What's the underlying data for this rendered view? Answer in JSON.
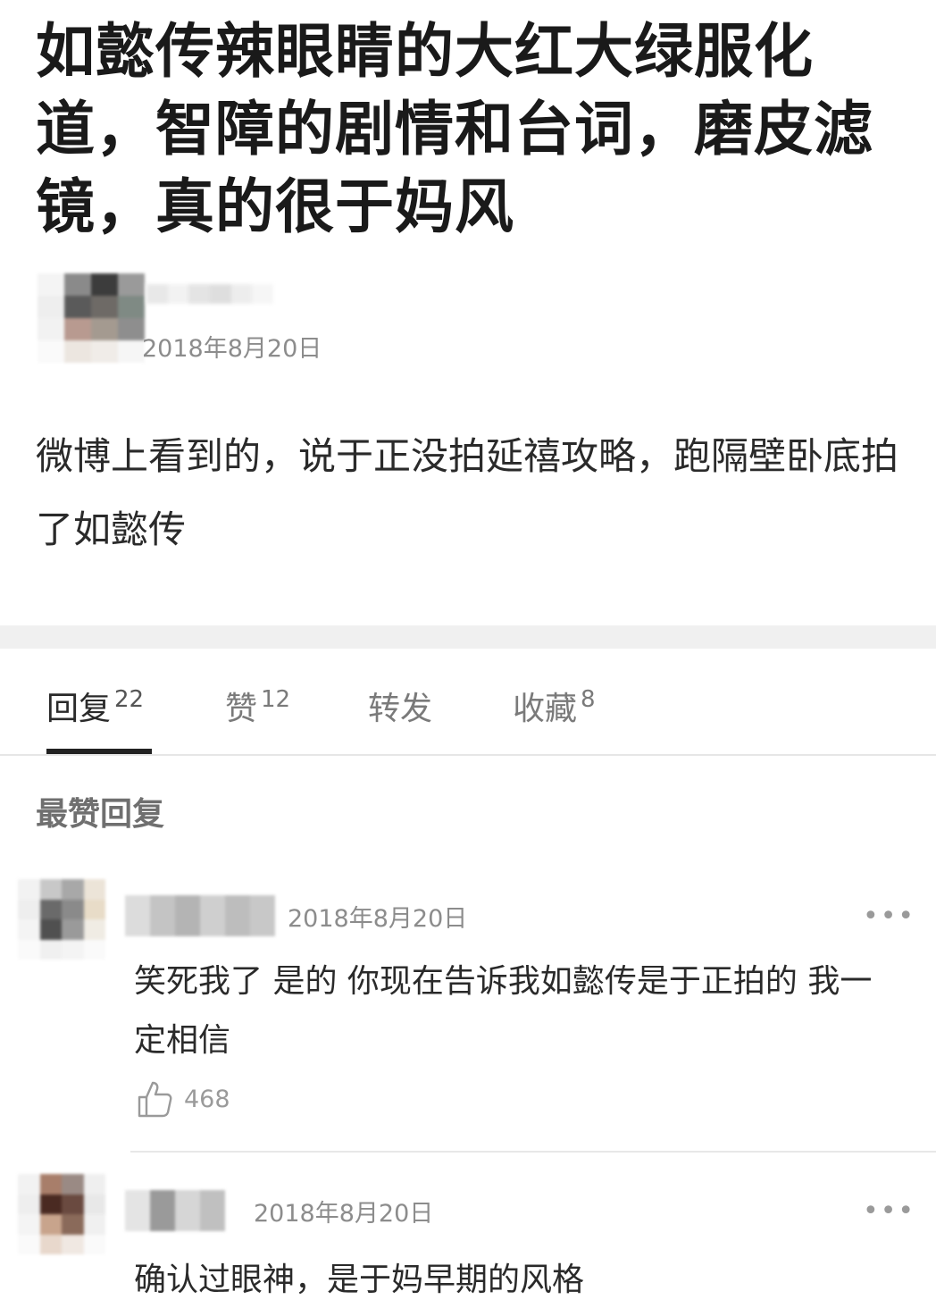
{
  "post": {
    "title": "如懿传辣眼睛的大红大绿服化道，智障的剧情和台词，磨皮滤镜，真的很于妈风",
    "date": "2018年8月20日",
    "body": "微博上看到的，说于正没拍延禧攻略，跑隔壁卧底拍了如懿传"
  },
  "tabs": [
    {
      "label": "回复",
      "count": "22"
    },
    {
      "label": "赞",
      "count": "12"
    },
    {
      "label": "转发",
      "count": ""
    },
    {
      "label": "收藏",
      "count": "8"
    }
  ],
  "section_title": "最赞回复",
  "comments": [
    {
      "date": "2018年8月20日",
      "text": "笑死我了 是的 你现在告诉我如懿传是于正拍的 我一定相信",
      "likes": "468",
      "more": "•••"
    },
    {
      "date": "2018年8月20日",
      "text": "确认过眼神，是于妈早期的风格",
      "more": "•••"
    }
  ],
  "icons": {
    "like": "thumbs-up-icon",
    "more": "more-dots-icon"
  },
  "colors": {
    "title": "#1a1a1a",
    "muted": "#8c8c8c",
    "band": "#f0f0f0",
    "active_tab_underline": "#222222"
  }
}
